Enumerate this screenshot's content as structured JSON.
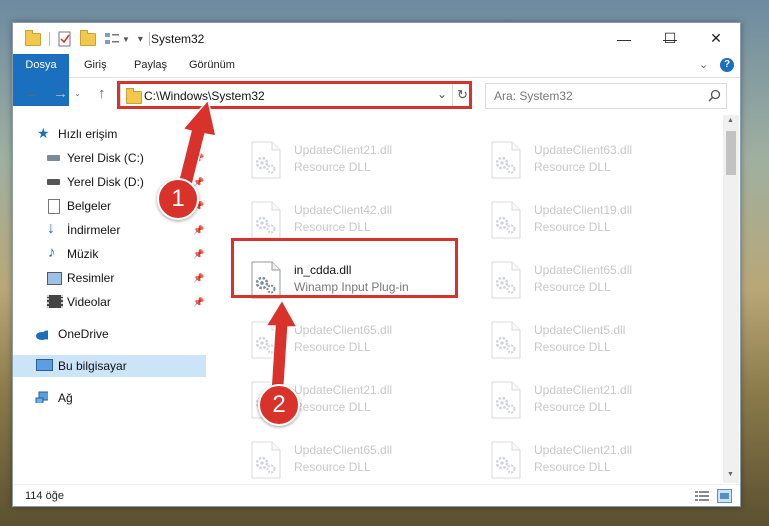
{
  "window": {
    "title": "System32",
    "controls": {
      "minimize": "—",
      "maximize": "☐",
      "close": "✕"
    }
  },
  "ribbon": {
    "tabs": [
      {
        "label": "Dosya",
        "active": true
      },
      {
        "label": "Giriş"
      },
      {
        "label": "Paylaş"
      },
      {
        "label": "Görünüm"
      }
    ],
    "expand_icon": "chevron-down-icon",
    "help_icon": "help-icon"
  },
  "address": {
    "path": "C:\\Windows\\System32",
    "search_placeholder": "Ara: System32"
  },
  "nav": {
    "items": [
      {
        "label": "Hızlı erişim",
        "icon": "star-icon",
        "pinned": false
      },
      {
        "label": "Yerel Disk (C:)",
        "icon": "drive-icon",
        "pinned": true
      },
      {
        "label": "Yerel Disk (D:)",
        "icon": "drive-icon",
        "pinned": true
      },
      {
        "label": "Belgeler",
        "icon": "documents-icon",
        "pinned": true
      },
      {
        "label": "İndirmeler",
        "icon": "download-icon",
        "pinned": true
      },
      {
        "label": "Müzik",
        "icon": "music-icon",
        "pinned": true
      },
      {
        "label": "Resimler",
        "icon": "pictures-icon",
        "pinned": true
      },
      {
        "label": "Videolar",
        "icon": "videos-icon",
        "pinned": true
      },
      {
        "label": "OneDrive",
        "icon": "cloud-icon",
        "pinned": false
      },
      {
        "label": "Bu bilgisayar",
        "icon": "computer-icon",
        "pinned": false,
        "selected": true
      },
      {
        "label": "Ağ",
        "icon": "network-icon",
        "pinned": false
      }
    ]
  },
  "files": [
    {
      "name": "UpdateClient21.dll",
      "desc": "Resource DLL"
    },
    {
      "name": "UpdateClient63.dll",
      "desc": "Resource DLL"
    },
    {
      "name": "UpdateClient42.dll",
      "desc": "Resource DLL"
    },
    {
      "name": "UpdateClient19.dll",
      "desc": "Resource DLL"
    },
    {
      "name": "in_cdda.dll",
      "desc": "Winamp Input Plug-in",
      "highlight": true
    },
    {
      "name": "UpdateClient65.dll",
      "desc": "Resource DLL"
    },
    {
      "name": "UpdateClient65.dll",
      "desc": "Resource DLL"
    },
    {
      "name": "UpdateClient5.dll",
      "desc": "Resource DLL"
    },
    {
      "name": "UpdateClient21.dll",
      "desc": "Resource DLL"
    },
    {
      "name": "UpdateClient21.dll",
      "desc": "Resource DLL"
    },
    {
      "name": "UpdateClient65.dll",
      "desc": "Resource DLL"
    },
    {
      "name": "UpdateClient21.dll",
      "desc": "Resource DLL"
    }
  ],
  "status": {
    "item_count": "114 öğe"
  },
  "annotations": {
    "step1": "1",
    "step2": "2"
  },
  "colors": {
    "accent": "#1a6fbf",
    "annotation_red": "#d9322b",
    "selection": "#cce4f7"
  }
}
